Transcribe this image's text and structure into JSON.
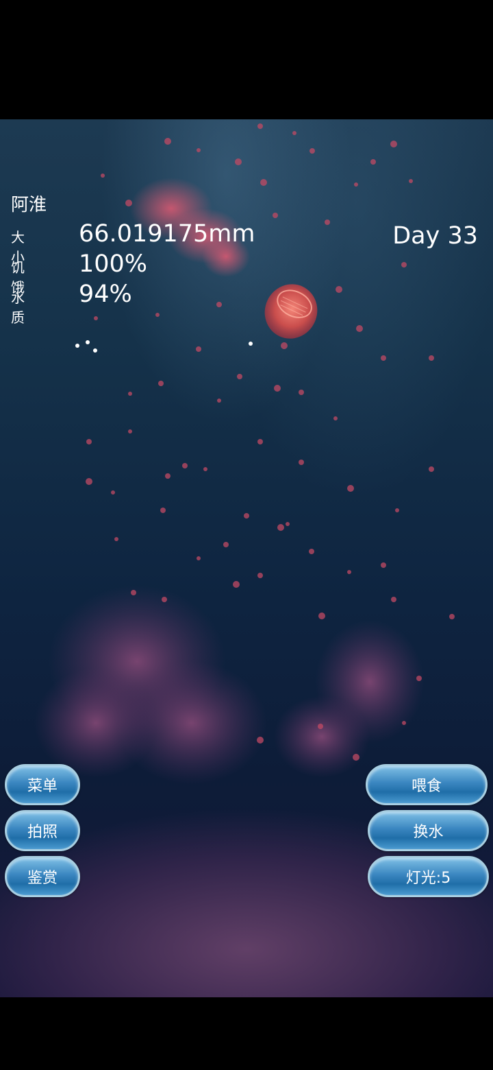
{
  "pet": {
    "name": "阿淮",
    "day": "Day 33"
  },
  "stats": {
    "size_label": "大小",
    "size_value": "66.019175mm",
    "hunger_label": "饥饿",
    "hunger_value": "100%",
    "water_label": "水质",
    "water_value": "94%"
  },
  "left_buttons": {
    "menu": "菜单",
    "photo": "拍照",
    "appreciate": "鉴赏"
  },
  "right_buttons": {
    "feed": "喂食",
    "change_water": "换水",
    "light": "灯光:5"
  },
  "colors": {
    "jellyfish": "#e8504a",
    "particles": "#c24a64",
    "button": "#3a86c0"
  }
}
